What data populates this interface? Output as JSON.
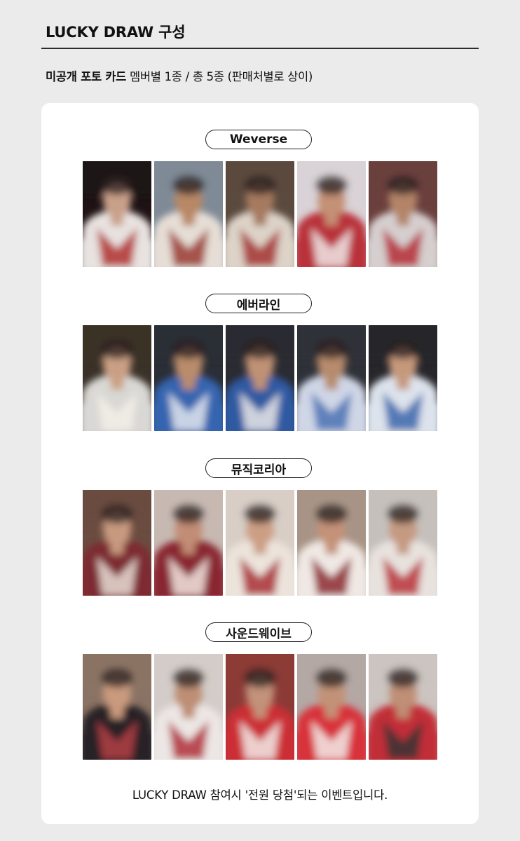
{
  "header": {
    "title": "LUCKY DRAW 구성"
  },
  "subtitle": {
    "strong": "미공개 포토 카드",
    "normal": " 멤버별 1종 / 총 5종 (판매처별로 상이)"
  },
  "sections": [
    {
      "store": "Weverse",
      "photos": [
        {
          "bg": "#1e1214",
          "face": "#c9a08a",
          "top": "#e8e2e0",
          "accent": "#b0302e"
        },
        {
          "bg": "#7f8a96",
          "face": "#b88866",
          "top": "#e6ded6",
          "accent": "#9a3a32"
        },
        {
          "bg": "#5b4a3e",
          "face": "#a67a5e",
          "top": "#ddd3c8",
          "accent": "#a43232"
        },
        {
          "bg": "#d9d2d6",
          "face": "#c49076",
          "top": "#b9333a",
          "accent": "#f0e8e8"
        },
        {
          "bg": "#6a3f3c",
          "face": "#b48468",
          "top": "#d6cfcf",
          "accent": "#b52d36"
        }
      ]
    },
    {
      "store": "에버라인",
      "photos": [
        {
          "bg": "#3a3128",
          "face": "#caa084",
          "top": "#d9d8d4",
          "accent": "#f2efe8"
        },
        {
          "bg": "#2a2e36",
          "face": "#b98c6c",
          "top": "#3465b0",
          "accent": "#e3e6ee"
        },
        {
          "bg": "#2b2b33",
          "face": "#c09274",
          "top": "#2f5aa2",
          "accent": "#e9e7e8"
        },
        {
          "bg": "#2f3138",
          "face": "#b78b6d",
          "top": "#cfd6e6",
          "accent": "#4a72b4"
        },
        {
          "bg": "#27262a",
          "face": "#c6997c",
          "top": "#dde3ec",
          "accent": "#3b66ad"
        }
      ]
    },
    {
      "store": "뮤직코리아",
      "photos": [
        {
          "bg": "#6b4c40",
          "face": "#c79a80",
          "top": "#7e2a30",
          "accent": "#e8ddd5"
        },
        {
          "bg": "#c7b9b2",
          "face": "#c28d76",
          "top": "#8a2730",
          "accent": "#f1e6e0"
        },
        {
          "bg": "#d8cec6",
          "face": "#cc9f84",
          "top": "#ece4dc",
          "accent": "#a93036"
        },
        {
          "bg": "#a89486",
          "face": "#c49278",
          "top": "#f0e8e4",
          "accent": "#8c2a30"
        },
        {
          "bg": "#c6c0bc",
          "face": "#c59a82",
          "top": "#e8e2de",
          "accent": "#b8323a"
        }
      ]
    },
    {
      "store": "사운드웨이브",
      "photos": [
        {
          "bg": "#8a7364",
          "face": "#c99a7e",
          "top": "#262226",
          "accent": "#b44046"
        },
        {
          "bg": "#d3ccc8",
          "face": "#be8f74",
          "top": "#ece6e4",
          "accent": "#b03038"
        },
        {
          "bg": "#8c3a36",
          "face": "#c2927a",
          "top": "#cc2e36",
          "accent": "#f1ebe8"
        },
        {
          "bg": "#b4a8a4",
          "face": "#c29278",
          "top": "#d8303a",
          "accent": "#f3ecea"
        },
        {
          "bg": "#cbc4c0",
          "face": "#bf8f76",
          "top": "#c22f38",
          "accent": "#3a3036"
        }
      ]
    }
  ],
  "footer": {
    "note": "LUCKY DRAW 참여시 '전원 당첨'되는 이벤트입니다."
  }
}
